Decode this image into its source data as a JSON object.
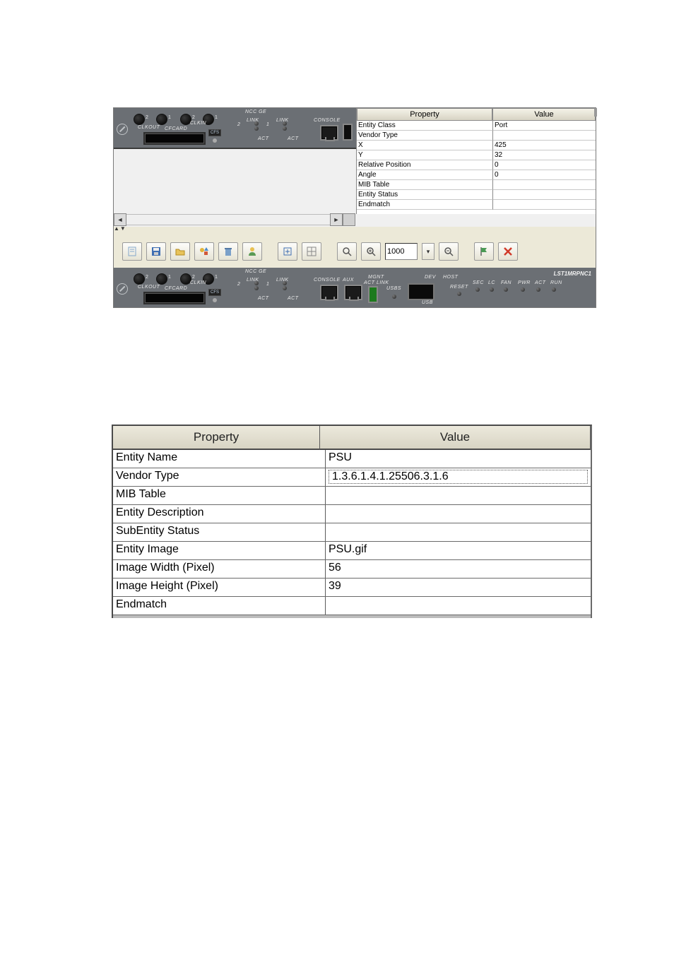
{
  "devicePanel": {
    "sectionLabel": "NCC GE",
    "clkout": "CLKOUT",
    "clkin": "CLKIN",
    "cfcard": "CFCARD",
    "cfs": "CFS",
    "linkLabel": "LINK",
    "actLabel": "ACT",
    "consoleLabel": "CONSOLE",
    "auxLabel": "AUX",
    "mgmtLabel": "MGNT",
    "mgmtActLink": "ACT LINK",
    "devLabel": "DEV",
    "hostLabel": "HOST",
    "usbsLabel": "USBS",
    "usbLabel": "USB",
    "resetLabel": "RESET",
    "statusSec": "SEC",
    "statusLc": "LC",
    "statusFan": "FAN",
    "statusPwr": "PWR",
    "statusAct": "ACT",
    "statusRun": "RUN",
    "productModel": "LST1MRPNC1",
    "knob1": "2",
    "knob2": "1",
    "knob3": "2",
    "knob4": "1",
    "port2": "2",
    "port1": "1"
  },
  "topTable": {
    "headers": {
      "property": "Property",
      "value": "Value"
    },
    "rows": [
      {
        "prop": "Entity Class",
        "val": "Port"
      },
      {
        "prop": "Vendor Type",
        "val": ""
      },
      {
        "prop": "X",
        "val": "425"
      },
      {
        "prop": "Y",
        "val": "32"
      },
      {
        "prop": "Relative Position",
        "val": "0"
      },
      {
        "prop": "Angle",
        "val": "0"
      },
      {
        "prop": "MIB Table",
        "val": ""
      },
      {
        "prop": "Entity Status",
        "val": ""
      },
      {
        "prop": "Endmatch",
        "val": ""
      }
    ]
  },
  "toolbar": {
    "zoomValue": "1000",
    "icons": {
      "newDoc": "new-doc-icon",
      "save": "save-icon",
      "folder": "folder-icon",
      "shapes": "shapes-icon",
      "delete": "delete-icon",
      "user": "user-icon",
      "fit": "fit-icon",
      "grid": "grid-icon",
      "magnify": "magnify-icon",
      "zoomIn": "zoom-in-icon",
      "zoomOut": "zoom-out-icon",
      "flag": "flag-icon",
      "close": "close-icon"
    }
  },
  "bottomTable": {
    "headers": {
      "property": "Property",
      "value": "Value"
    },
    "rows": [
      {
        "prop": "Entity Name",
        "val": "PSU"
      },
      {
        "prop": "Vendor Type",
        "val": "1.3.6.1.4.1.25506.3.1.6",
        "dotted": true
      },
      {
        "prop": "MIB Table",
        "val": ""
      },
      {
        "prop": "Entity Description",
        "val": ""
      },
      {
        "prop": "SubEntity Status",
        "val": ""
      },
      {
        "prop": "Entity Image",
        "val": "PSU.gif"
      },
      {
        "prop": "Image Width (Pixel)",
        "val": "56"
      },
      {
        "prop": "Image Height (Pixel)",
        "val": "39"
      },
      {
        "prop": "Endmatch",
        "val": ""
      }
    ]
  }
}
